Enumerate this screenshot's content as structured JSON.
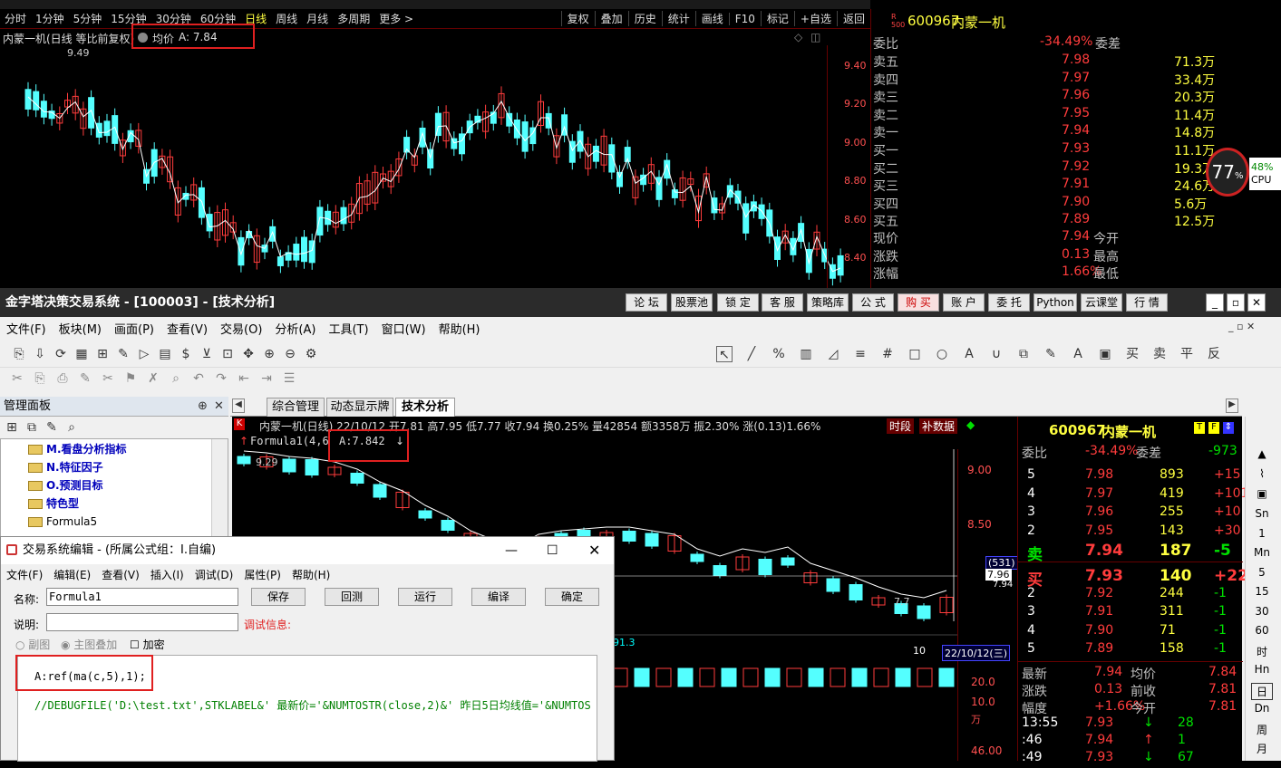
{
  "back": {
    "tabs": [
      "分时",
      "1分钟",
      "5分钟",
      "15分钟",
      "30分钟",
      "60分钟",
      "日线",
      "周线",
      "月线",
      "多周期",
      "更多 >"
    ],
    "buttons": [
      "复权",
      "叠加",
      "历史",
      "统计",
      "画线",
      "F10",
      "标记",
      "+自选",
      "返回"
    ],
    "info_title": "内蒙一机(日线 等比前复权)",
    "info_ma": "均价",
    "info_ma_val": "A: 7.84",
    "high_label": "9.49",
    "axis": [
      "9.40",
      "9.20",
      "9.00",
      "8.80",
      "8.60",
      "8.40"
    ],
    "quote": {
      "code": "600967",
      "name": "内蒙一机",
      "r500": "R 500",
      "webi_label": "委比",
      "webi": "-34.49%",
      "weicha": "委差",
      "asks": [
        {
          "l": "卖五",
          "p": "7.98",
          "v": "71.3万"
        },
        {
          "l": "卖四",
          "p": "7.97",
          "v": "33.4万"
        },
        {
          "l": "卖三",
          "p": "7.96",
          "v": "20.3万"
        },
        {
          "l": "卖二",
          "p": "7.95",
          "v": "11.4万"
        },
        {
          "l": "卖一",
          "p": "7.94",
          "v": "14.8万"
        }
      ],
      "bids": [
        {
          "l": "买一",
          "p": "7.93",
          "v": "11.1万"
        },
        {
          "l": "买二",
          "p": "7.92",
          "v": "19.3万"
        },
        {
          "l": "买三",
          "p": "7.91",
          "v": "24.6万"
        },
        {
          "l": "买四",
          "p": "7.90",
          "v": "5.6万"
        },
        {
          "l": "买五",
          "p": "7.89",
          "v": "12.5万"
        }
      ],
      "stats": [
        {
          "l": "现价",
          "v": "7.94",
          "r": "今开"
        },
        {
          "l": "涨跌",
          "v": "0.13",
          "r": "最高"
        },
        {
          "l": "涨幅",
          "v": "1.66%",
          "r": "最低"
        }
      ]
    },
    "cpu": "77",
    "cpu_pct": "%",
    "cpu_side": "48%",
    "cpu_side2": "CPU"
  },
  "front": {
    "title": "金字塔决策交易系统 - [100003] - [技术分析]",
    "title_buttons": [
      "论 坛",
      "股票池",
      "锁 定",
      "客 服",
      "策略库",
      "公 式",
      "购 买",
      "账 户",
      "委 托",
      "Python",
      "云课堂",
      "行 情"
    ],
    "menu": [
      "文件(F)",
      "板块(M)",
      "画面(P)",
      "查看(V)",
      "交易(O)",
      "分析(A)",
      "工具(T)",
      "窗口(W)",
      "帮助(H)"
    ],
    "panel_title": "管理面板",
    "tree": [
      {
        "t": "M.看盘分析指标",
        "b": true
      },
      {
        "t": "N.特征因子",
        "b": true
      },
      {
        "t": "O.预测目标",
        "b": true
      },
      {
        "t": "特色型",
        "b": true
      },
      {
        "t": "Formula5",
        "b": false
      }
    ],
    "tabs": [
      "综合管理",
      "动态显示牌",
      "技术分析"
    ],
    "chart_info": "内蒙一机(日线) 22/10/12 开7.81 高7.95 低7.77 收7.94 换0.25% 量42854 额3358万 振2.30% 涨(0.13)1.66%",
    "chart_btns": [
      "时段",
      "补数据"
    ],
    "formula_label": "Formula1(4,6",
    "formula_val": "A:7.842",
    "high_label": "9.29",
    "axis": [
      "9.00",
      "8.50"
    ],
    "price_tag": "(531)",
    "price_tag2": "7.96",
    "price_tag3": "7.94",
    "date_tag": "22/10/12(三)",
    "date_tag_left": "10",
    "lower_label": "91.3",
    "lower_axis": [
      "20.0",
      "10.0",
      "万",
      "46.00"
    ],
    "low_label": "7.7",
    "quote": {
      "code": "600967",
      "name": "内蒙一机",
      "webi_label": "委比",
      "webi": "-34.49%",
      "weicha": "委差",
      "weicha_val": "-973",
      "asks": [
        {
          "l": "5",
          "p": "7.98",
          "v": "893",
          "c": "+15"
        },
        {
          "l": "4",
          "p": "7.97",
          "v": "419",
          "c": "+101"
        },
        {
          "l": "3",
          "p": "7.96",
          "v": "255",
          "c": "+10"
        },
        {
          "l": "2",
          "p": "7.95",
          "v": "143",
          "c": "+30"
        },
        {
          "l": "卖",
          "p": "7.94",
          "v": "187",
          "c": "-5"
        }
      ],
      "bids": [
        {
          "l": "买",
          "p": "7.93",
          "v": "140",
          "c": "+22"
        },
        {
          "l": "2",
          "p": "7.92",
          "v": "244",
          "c": "-1"
        },
        {
          "l": "3",
          "p": "7.91",
          "v": "311",
          "c": "-1"
        },
        {
          "l": "4",
          "p": "7.90",
          "v": "71",
          "c": "-1"
        },
        {
          "l": "5",
          "p": "7.89",
          "v": "158",
          "c": "-1"
        }
      ],
      "stats": [
        {
          "l": "最新",
          "v": "7.94",
          "r": "均价",
          "rv": "7.84"
        },
        {
          "l": "涨跌",
          "v": "0.13",
          "r": "前收",
          "rv": "7.81"
        },
        {
          "l": "幅度",
          "v": "+1.66%",
          "r": "今开",
          "rv": "7.81"
        }
      ],
      "ticks": [
        {
          "t": "13:55",
          "p": "7.93",
          "v": "28"
        },
        {
          "t": ":46",
          "p": "7.94",
          "v": "1"
        },
        {
          "t": ":49",
          "p": "7.93",
          "v": "67"
        }
      ]
    },
    "right_tools": [
      "Sn",
      "1",
      "Mn",
      "5",
      "15",
      "30",
      "60",
      "时",
      "Hn",
      "日",
      "Dn",
      "周",
      "月"
    ]
  },
  "dialog": {
    "title": "交易系统编辑 - (所属公式组：I.自编)",
    "menu": [
      "文件(F)",
      "编辑(E)",
      "查看(V)",
      "插入(I)",
      "调试(D)",
      "属性(P)",
      "帮助(H)"
    ],
    "name_label": "名称:",
    "name_value": "Formula1",
    "desc_label": "说明:",
    "debug_label": "调试信息:",
    "buttons": [
      "保存",
      "回测",
      "运行",
      "编译",
      "确定"
    ],
    "opt1": "副图",
    "opt2": "主图叠加",
    "opt3": "加密",
    "code1": "A:ref(ma(c,5),1);",
    "code2": "//DEBUGFILE('D:\\test.txt',STKLABEL&'  最新价='&NUMTOSTR(close,2)&' 昨日5日均线值='&NUMTOS"
  }
}
